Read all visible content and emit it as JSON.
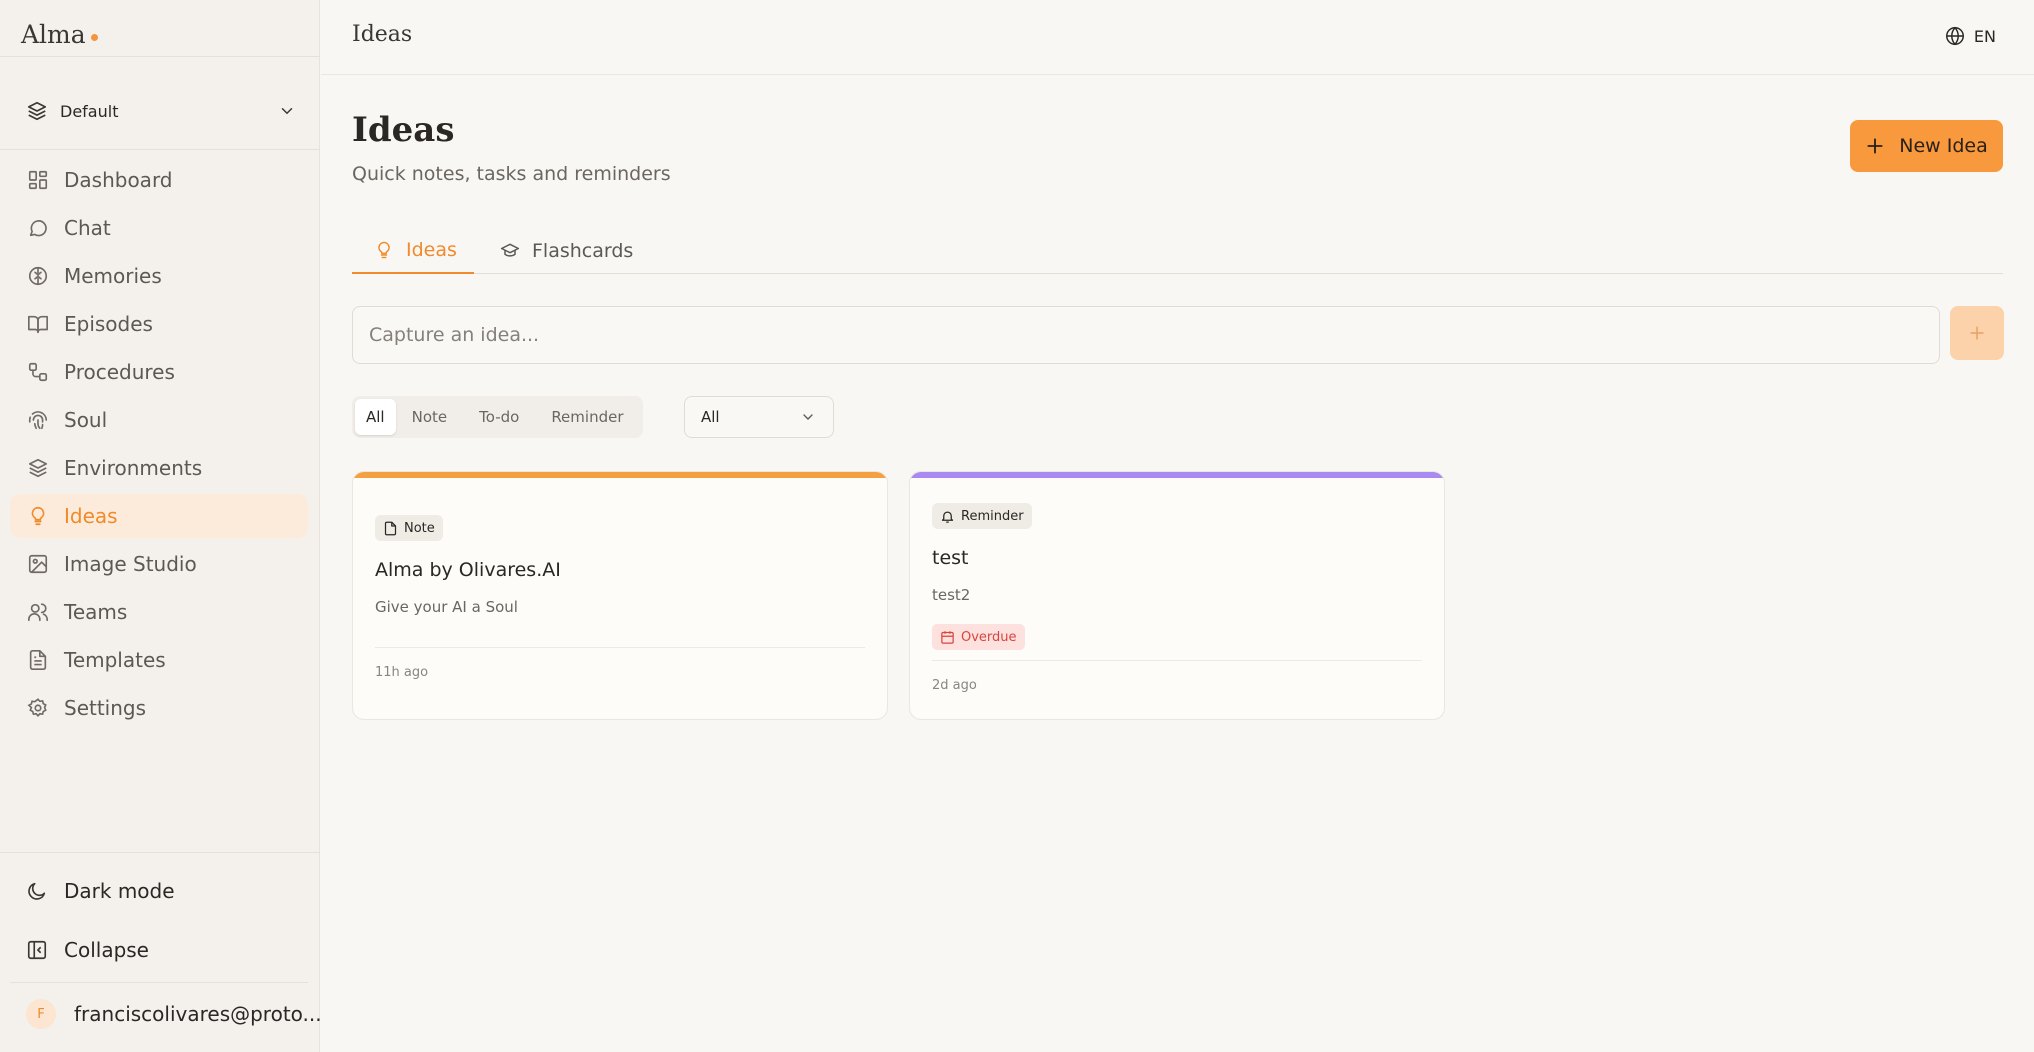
{
  "app": {
    "name": "Alma",
    "accent": "#f5943a"
  },
  "sidebar": {
    "environment": {
      "label": "Default"
    },
    "items": [
      {
        "label": "Dashboard",
        "icon": "dashboard-icon"
      },
      {
        "label": "Chat",
        "icon": "chat-icon"
      },
      {
        "label": "Memories",
        "icon": "brain-icon"
      },
      {
        "label": "Episodes",
        "icon": "book-icon"
      },
      {
        "label": "Procedures",
        "icon": "workflow-icon"
      },
      {
        "label": "Soul",
        "icon": "fingerprint-icon"
      },
      {
        "label": "Environments",
        "icon": "layers-icon"
      },
      {
        "label": "Ideas",
        "icon": "lightbulb-icon",
        "active": true
      },
      {
        "label": "Image Studio",
        "icon": "image-icon"
      },
      {
        "label": "Teams",
        "icon": "users-icon"
      },
      {
        "label": "Templates",
        "icon": "file-text-icon"
      },
      {
        "label": "Settings",
        "icon": "gear-icon"
      }
    ],
    "dark_mode_label": "Dark mode",
    "collapse_label": "Collapse",
    "user": {
      "initial": "F",
      "email": "franciscolivares@proto..."
    }
  },
  "header": {
    "title": "Ideas",
    "language": "EN"
  },
  "main": {
    "title": "Ideas",
    "subtitle": "Quick notes, tasks and reminders",
    "new_button_label": "New Idea",
    "tabs": [
      {
        "label": "Ideas",
        "active": true
      },
      {
        "label": "Flashcards",
        "active": false
      }
    ],
    "capture": {
      "placeholder": "Capture an idea...",
      "value": ""
    },
    "filters": [
      {
        "label": "All",
        "active": true
      },
      {
        "label": "Note"
      },
      {
        "label": "To-do"
      },
      {
        "label": "Reminder"
      }
    ],
    "select": {
      "value": "All"
    },
    "cards": [
      {
        "type": "Note",
        "title": "Alma by Olivares.AI",
        "description": "Give your AI a Soul",
        "time": "11h ago",
        "accent": "#f5a040"
      },
      {
        "type": "Reminder",
        "title": "test",
        "description": "test2",
        "status": "Overdue",
        "time": "2d ago",
        "accent": "#a98af0"
      }
    ]
  }
}
